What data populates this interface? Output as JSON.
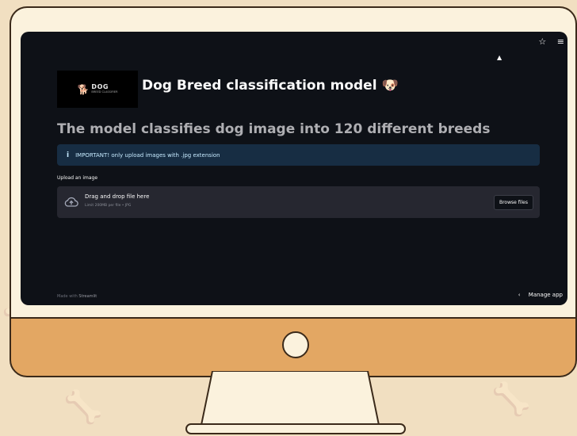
{
  "app": {
    "title": "Dog Breed classification model 🐶",
    "logo_title": "DOG",
    "logo_subtitle": "BREED CLASSIFIER"
  },
  "toolbar": {
    "star_icon": "☆",
    "menu_icon": "≡"
  },
  "main": {
    "subtitle": "The model classifies dog image into 120 different breeds",
    "info_text": "IMPORTANT! only upload images with .jpg extension",
    "info_icon": "i",
    "upload_label": "Upload an image",
    "dropzone_text": "Drag and drop file here",
    "dropzone_limit": "Limit 200MB per file • JPG",
    "browse_label": "Browse files"
  },
  "footer": {
    "made_with": "Made with",
    "brand": "Streamlit",
    "manage_app": "Manage app",
    "manage_chevron": "‹"
  },
  "colors": {
    "screen_bg": "#0e1117",
    "info_bg": "#172d43",
    "dropzone_bg": "#262730",
    "monitor_chin": "#e3a763",
    "page_bg": "#f1dfc1"
  }
}
